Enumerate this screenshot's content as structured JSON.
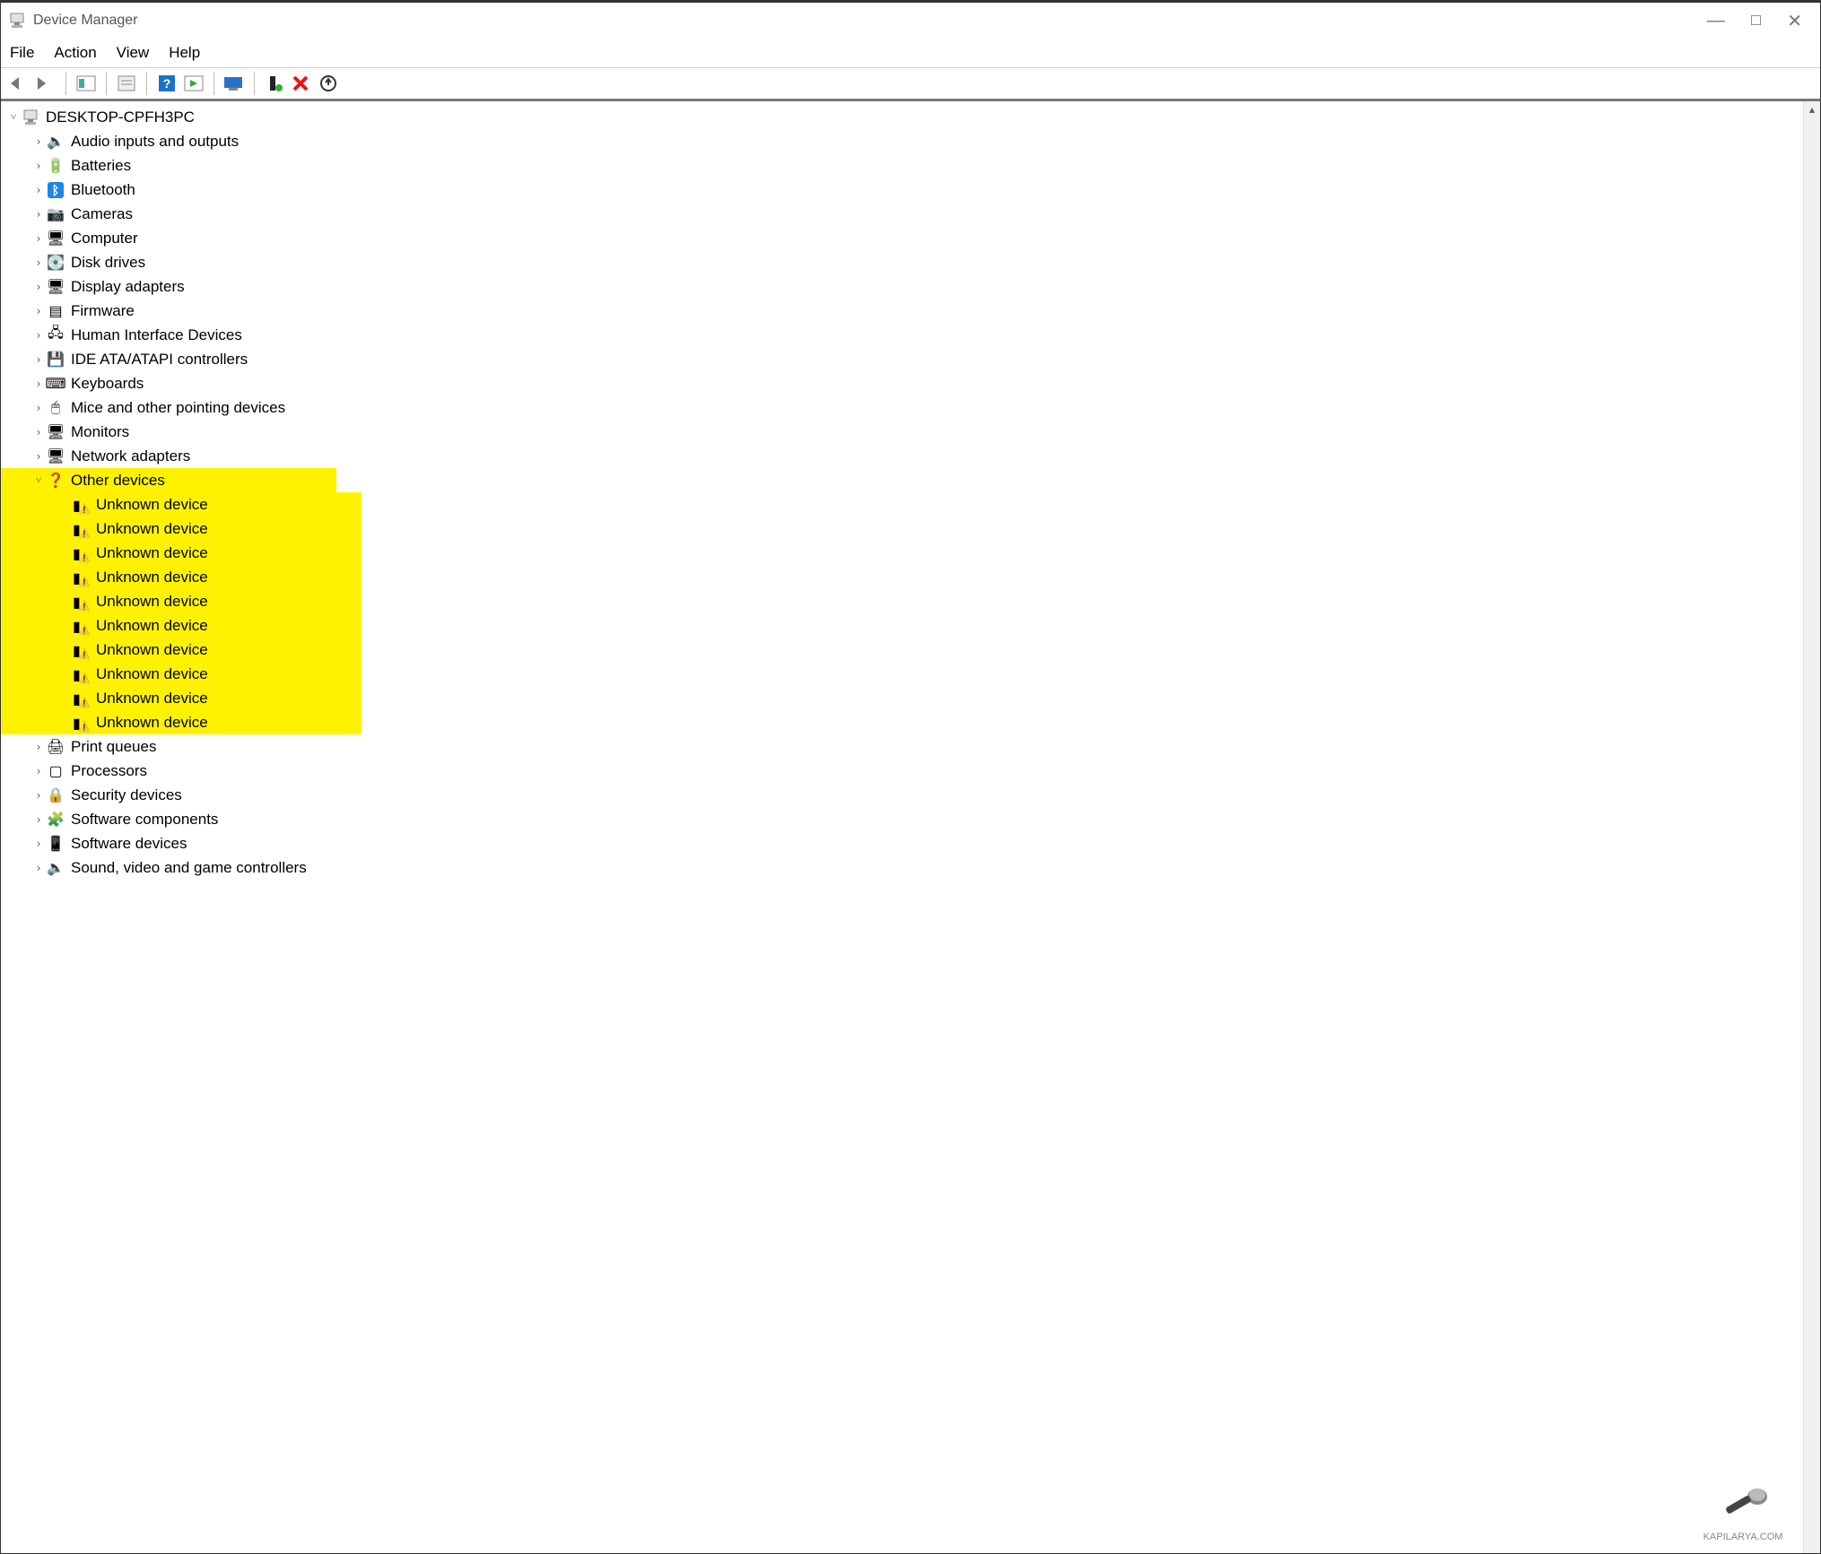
{
  "title": "Device Manager",
  "menus": {
    "file": "File",
    "action": "Action",
    "view": "View",
    "help": "Help"
  },
  "toolbar": {
    "back": "back",
    "forward": "forward",
    "show_hide": "show-hide-console-tree",
    "properties": "properties",
    "help": "help",
    "show_hidden": "show-hidden-devices",
    "scan": "scan-for-hardware-changes",
    "add_legacy": "add-legacy-hardware",
    "remove": "remove-device",
    "update_driver": "update-driver"
  },
  "root": {
    "name": "DESKTOP-CPFH3PC",
    "expanded": true
  },
  "categories": [
    {
      "name": "Audio inputs and outputs",
      "icon": "🔈"
    },
    {
      "name": "Batteries",
      "icon": "🔋"
    },
    {
      "name": "Bluetooth",
      "icon": "ᛒ",
      "iconColor": "#fff",
      "iconBg": "#1b87e6"
    },
    {
      "name": "Cameras",
      "icon": "📷"
    },
    {
      "name": "Computer",
      "icon": "🖥"
    },
    {
      "name": "Disk drives",
      "icon": "💽"
    },
    {
      "name": "Display adapters",
      "icon": "🖥"
    },
    {
      "name": "Firmware",
      "icon": "▤"
    },
    {
      "name": "Human Interface Devices",
      "icon": "🖧"
    },
    {
      "name": "IDE ATA/ATAPI controllers",
      "icon": "💾"
    },
    {
      "name": "Keyboards",
      "icon": "⌨"
    },
    {
      "name": "Mice and other pointing devices",
      "icon": "🖱"
    },
    {
      "name": "Monitors",
      "icon": "🖥"
    },
    {
      "name": "Network adapters",
      "icon": "🖥"
    },
    {
      "name": "Other devices",
      "icon": "❓",
      "expanded": true,
      "highlight": true,
      "children": [
        "Unknown device",
        "Unknown device",
        "Unknown device",
        "Unknown device",
        "Unknown device",
        "Unknown device",
        "Unknown device",
        "Unknown device",
        "Unknown device",
        "Unknown device"
      ]
    },
    {
      "name": "Print queues",
      "icon": "🖨"
    },
    {
      "name": "Processors",
      "icon": "▢"
    },
    {
      "name": "Security devices",
      "icon": "🔒"
    },
    {
      "name": "Software components",
      "icon": "🧩"
    },
    {
      "name": "Software devices",
      "icon": "📱"
    },
    {
      "name": "Sound, video and game controllers",
      "icon": "🔈"
    }
  ],
  "child_icon": "⚠",
  "watermark": "KAPILARYA.COM"
}
